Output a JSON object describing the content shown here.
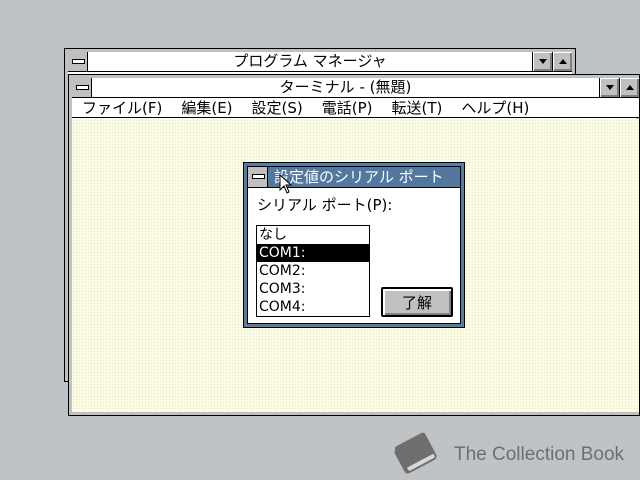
{
  "program_manager": {
    "title": "プログラム マネージャ"
  },
  "terminal": {
    "title": "ターミナル - (無題)",
    "menu": [
      {
        "label": "ファイル(F)"
      },
      {
        "label": "編集(E)"
      },
      {
        "label": "設定(S)"
      },
      {
        "label": "電話(P)"
      },
      {
        "label": "転送(T)"
      },
      {
        "label": "ヘルプ(H)"
      }
    ]
  },
  "dialog": {
    "title": "設定値のシリアル ポート",
    "port_label": "シリアル ポート(P):",
    "ports": [
      {
        "label": "なし",
        "selected": false
      },
      {
        "label": "COM1:",
        "selected": true
      },
      {
        "label": "COM2:",
        "selected": false
      },
      {
        "label": "COM3:",
        "selected": false
      },
      {
        "label": "COM4:",
        "selected": false
      }
    ],
    "ok_label": "了解"
  },
  "watermark": {
    "text": "The Collection Book"
  },
  "colors": {
    "desktop": "#c0c3c6",
    "dialog_title_active": "#5378a0",
    "terminal_client": "#fdfde6",
    "selection": "#000000"
  },
  "icons": {
    "system_menu": "system-menu-icon",
    "minimize": "minimize-icon",
    "maximize": "maximize-icon",
    "cursor": "mouse-pointer-icon",
    "watermark_logo": "book-icon"
  }
}
